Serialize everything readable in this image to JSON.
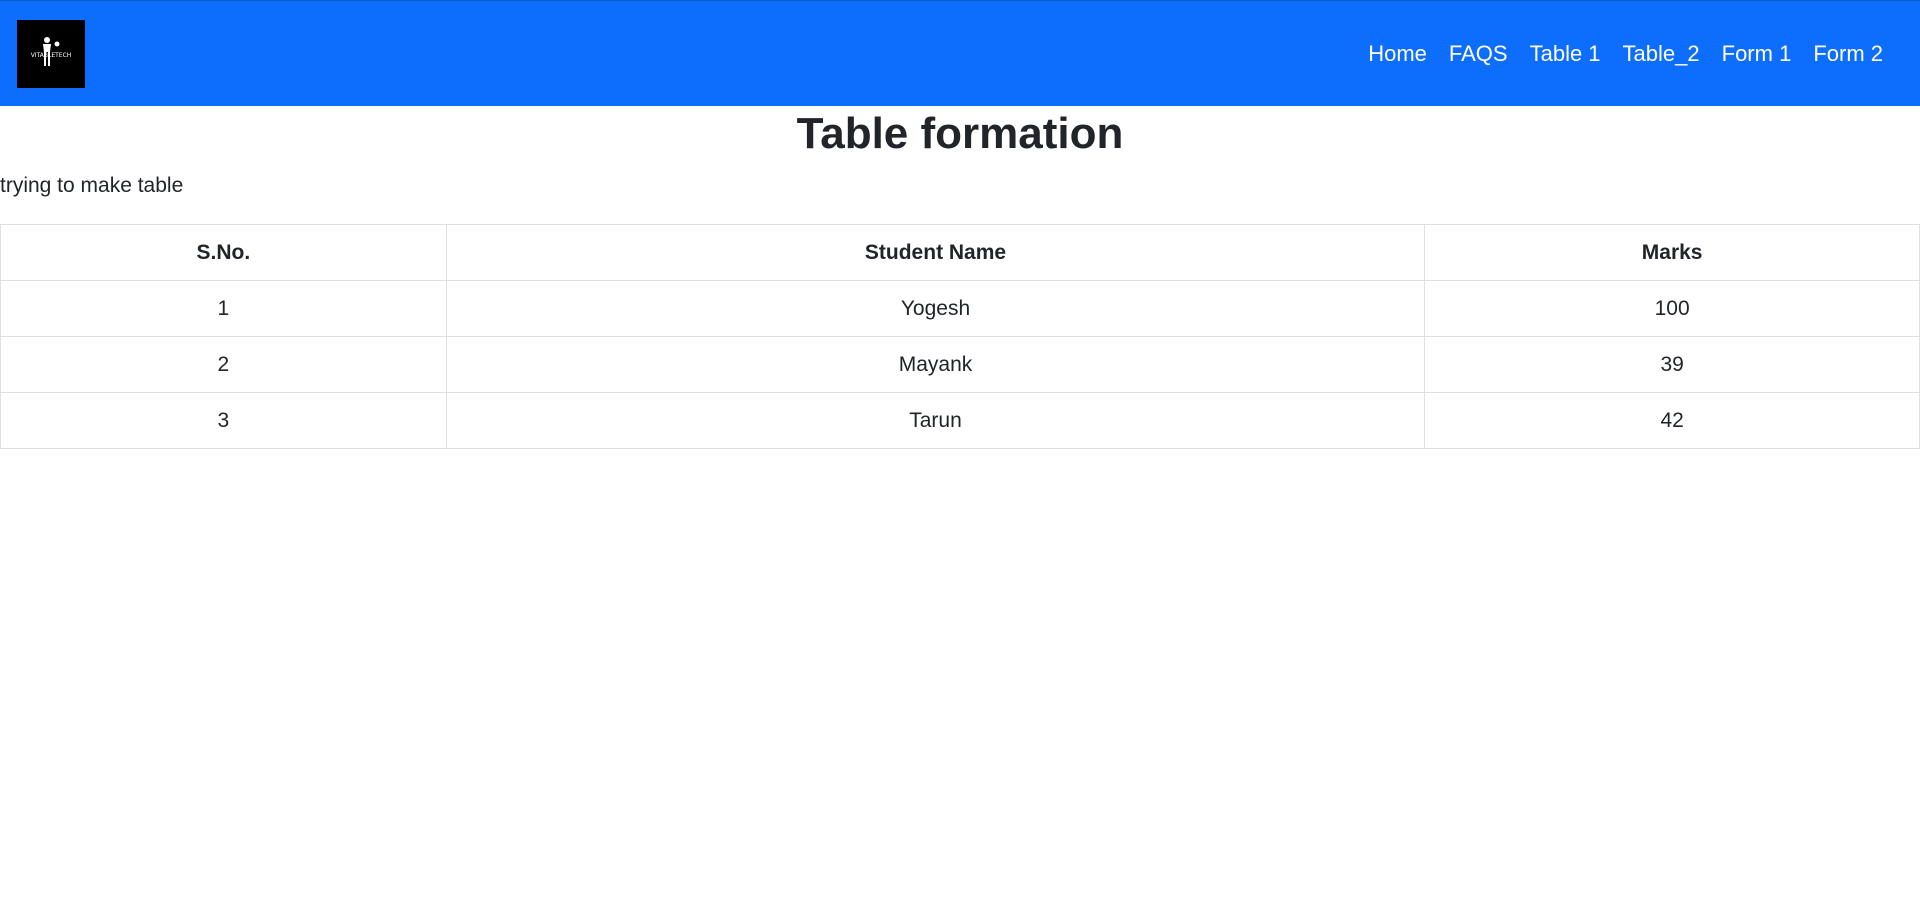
{
  "navbar": {
    "logo_text": "VITABLETECH",
    "links": [
      "Home",
      "FAQS",
      "Table 1",
      "Table_2",
      "Form 1",
      "Form 2"
    ],
    "background_color": "#0d6efd"
  },
  "main": {
    "title": "Table formation",
    "subtitle": "trying to make table"
  },
  "table": {
    "headers": [
      "S.No.",
      "Student Name",
      "Marks"
    ],
    "rows": [
      [
        "1",
        "Yogesh",
        "100"
      ],
      [
        "2",
        "Mayank",
        "39"
      ],
      [
        "3",
        "Tarun",
        "42"
      ]
    ]
  }
}
